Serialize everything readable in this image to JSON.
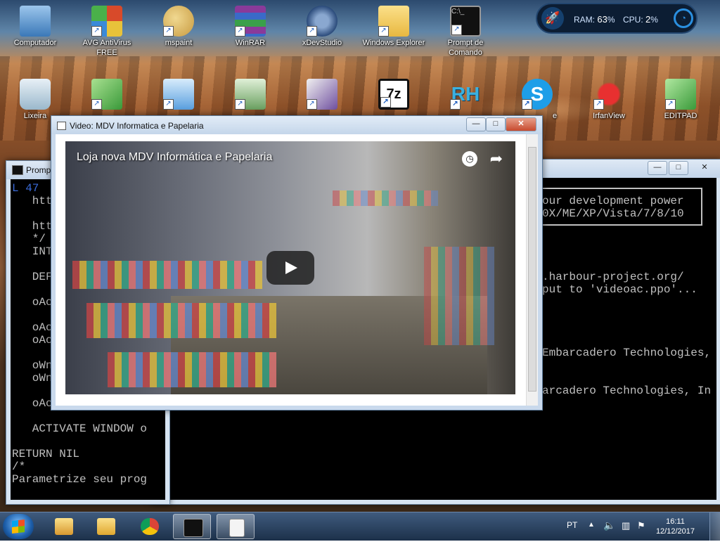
{
  "desktop_icons": [
    {
      "label": "Computador",
      "icon": "computer-icon",
      "color": "#6aa3d8"
    },
    {
      "label": "AVG AntiVirus FREE",
      "icon": "avg-antivirus-icon",
      "color": "#d84a2a"
    },
    {
      "label": "mspaint",
      "icon": "paint-palette-icon",
      "color": "#e0c070"
    },
    {
      "label": "WinRAR",
      "icon": "winrar-books-icon",
      "color": "#8a3a9a"
    },
    {
      "label": "xDevStudio",
      "icon": "xdevstudio-gear-icon",
      "color": "#4a6a9a"
    },
    {
      "label": "Windows Explorer",
      "icon": "folder-icon",
      "color": "#f0c84a"
    },
    {
      "label": "Prompt de Comando",
      "icon": "command-prompt-icon",
      "color": "#111111"
    },
    {
      "label": "Lixeira",
      "icon": "recycle-bin-icon",
      "color": "#b8d0e0"
    },
    {
      "label": "",
      "icon": "notepad-green-icon",
      "color": "#5ab04a"
    },
    {
      "label": "",
      "icon": "form-designer-icon",
      "color": "#5aa0e0"
    },
    {
      "label": "",
      "icon": "xml-file-icon",
      "color": "#6aa060"
    },
    {
      "label": "",
      "icon": "text-editor-pen-icon",
      "color": "#7050a0"
    },
    {
      "label": "",
      "icon": "seven-zip-icon",
      "color": "#f4f4f4"
    },
    {
      "label": "",
      "icon": "rh-icon",
      "color": "#3ab0e0"
    },
    {
      "label": "",
      "icon": "skype-icon",
      "color": "#1e9ee8"
    },
    {
      "label": "IrfanView",
      "icon": "irfanview-icon",
      "color": "#c82020"
    },
    {
      "label": "EDITPAD",
      "icon": "editpad-icon",
      "color": "#50b050"
    }
  ],
  "skype_partial_label": "e",
  "system_monitor": {
    "ram_label": "RAM:",
    "ram_value": "63",
    "cpu_label": "CPU:",
    "cpu_value": "2",
    "unit": "%"
  },
  "console_left": {
    "title": "Promp",
    "lines": [
      "L 47",
      "   htt",
      "",
      "   htt",
      "   */",
      "   INT",
      "",
      "   DEF",
      "",
      "   oAc",
      "",
      "   oAc",
      "   oAc",
      "",
      "   oWn",
      "   oWn",
      "",
      "   oAc",
      "",
      "   ACTIVATE WINDOW o",
      "",
      "RETURN NIL",
      "/*",
      "Parametrize seu prog"
    ]
  },
  "console_right": {
    "lines": [
      "our development power",
      "0X/ME/XP/Vista/7/8/10",
      "",
      "",
      "",
      "",
      ".harbour-project.org/",
      "put to 'videoac.ppo'...",
      "",
      "",
      "",
      "",
      "Embarcadero Technologies,",
      "",
      "",
      "arcadero Technologies, In"
    ]
  },
  "video_window": {
    "title": "Video: MDV Informatica e Papelaria",
    "video_title": "Loja nova MDV Informática e Papelaria"
  },
  "window_buttons": {
    "minimize": "—",
    "maximize": "□",
    "close": "✕"
  },
  "taskbar": {
    "pinned": [
      {
        "icon": "outlook-mail-icon",
        "color": "#e8b040"
      },
      {
        "icon": "file-explorer-icon",
        "color": "#f0c84a"
      },
      {
        "icon": "chrome-icon",
        "color": "#db4437"
      },
      {
        "icon": "command-prompt-icon",
        "color": "#111111"
      },
      {
        "icon": "video-app-icon",
        "color": "#e8e8e8"
      }
    ],
    "language": "PT",
    "time": "16:11",
    "date": "12/12/2017"
  }
}
